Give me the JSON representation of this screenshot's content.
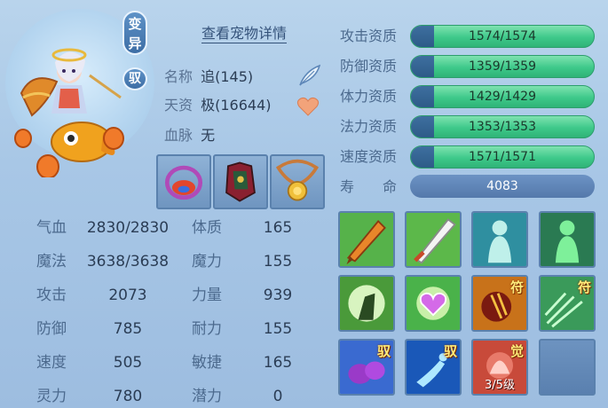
{
  "pet": {
    "badge_bian": "变异",
    "badge_yu": "驭",
    "details_link": "查看宠物详情",
    "name_label": "名称",
    "name_value": "追(145)",
    "talent_label": "天资",
    "talent_value": "极(16644)",
    "bloodline_label": "血脉",
    "bloodline_value": "无"
  },
  "stats": [
    {
      "label": "气血",
      "value": "2830/2830"
    },
    {
      "label": "魔法",
      "value": "3638/3638"
    },
    {
      "label": "攻击",
      "value": "2073"
    },
    {
      "label": "防御",
      "value": "785"
    },
    {
      "label": "速度",
      "value": "505"
    },
    {
      "label": "灵力",
      "value": "780"
    }
  ],
  "attributes": [
    {
      "label": "体质",
      "value": "165"
    },
    {
      "label": "魔力",
      "value": "155"
    },
    {
      "label": "力量",
      "value": "939"
    },
    {
      "label": "耐力",
      "value": "155"
    },
    {
      "label": "敏捷",
      "value": "165"
    },
    {
      "label": "潜力",
      "value": "0"
    }
  ],
  "aptitudes": [
    {
      "label": "攻击资质",
      "value": "1574/1574",
      "fill": 1.0
    },
    {
      "label": "防御资质",
      "value": "1359/1359",
      "fill": 1.0
    },
    {
      "label": "体力资质",
      "value": "1429/1429",
      "fill": 1.0
    },
    {
      "label": "法力资质",
      "value": "1353/1353",
      "fill": 1.0
    },
    {
      "label": "速度资质",
      "value": "1571/1571",
      "fill": 1.0
    }
  ],
  "life": {
    "label": "寿　　命",
    "value": "4083"
  },
  "skills": [
    {
      "icon": "fire-sword-skill-icon",
      "tag": "",
      "level": ""
    },
    {
      "icon": "sword-skill-icon",
      "tag": "",
      "level": ""
    },
    {
      "icon": "shadow-figure-skill-icon",
      "tag": "",
      "level": ""
    },
    {
      "icon": "green-figure-skill-icon",
      "tag": "",
      "level": ""
    },
    {
      "icon": "warrior-skill-icon",
      "tag": "",
      "level": ""
    },
    {
      "icon": "heart-skill-icon",
      "tag": "",
      "level": ""
    },
    {
      "icon": "fire-claw-skill-icon",
      "tag": "符",
      "level": ""
    },
    {
      "icon": "green-burst-skill-icon",
      "tag": "符",
      "level": ""
    },
    {
      "icon": "fist-skill-icon",
      "tag": "驭",
      "level": ""
    },
    {
      "icon": "runner-skill-icon",
      "tag": "驭",
      "level": ""
    },
    {
      "icon": "awaken-skill-icon",
      "tag": "觉",
      "level": "3/5级"
    },
    {
      "icon": "empty-slot",
      "tag": "",
      "level": ""
    }
  ]
}
